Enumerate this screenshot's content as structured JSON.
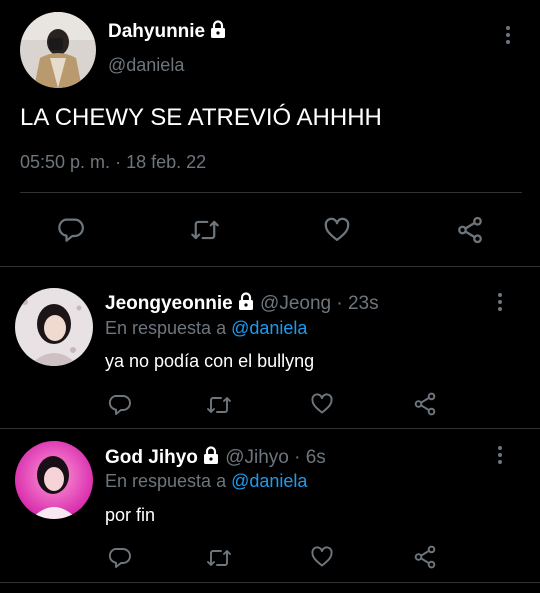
{
  "main_tweet": {
    "display_name": "Dahyunnie",
    "handle": "@daniela",
    "text": "LA CHEWY SE ATREVIÓ AHHHH",
    "time": "05:50 p. m.",
    "separator": "·",
    "date": "18 feb. 22"
  },
  "replies": [
    {
      "display_name": "Jeongyeonnie",
      "handle": "@Jeong",
      "age": "· 23s",
      "reply_prefix": "En respuesta a",
      "reply_to": "@daniela",
      "text": "ya no podía con el bullyng"
    },
    {
      "display_name": "God Jihyo",
      "handle": "@Jihyo",
      "age": "· 6s",
      "reply_prefix": "En respuesta a",
      "reply_to": "@daniela",
      "text": "por fin"
    }
  ],
  "colors": {
    "background": "#000000",
    "text": "#ffffff",
    "muted": "#6e767d",
    "link": "#1d9bf0",
    "divider": "#2f3336"
  },
  "icons": [
    "lock-icon",
    "more-options-icon",
    "reply-icon",
    "retweet-icon",
    "like-icon",
    "share-icon"
  ]
}
